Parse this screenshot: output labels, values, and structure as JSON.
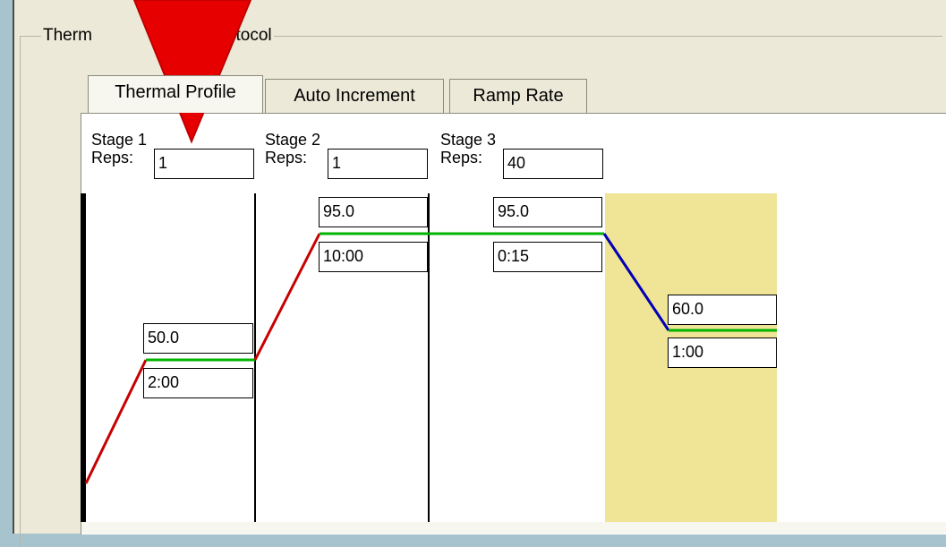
{
  "group": {
    "title_visible_left": "Therm",
    "title_visible_right": "otocol"
  },
  "tabs": [
    {
      "label": "Thermal Profile",
      "active": true
    },
    {
      "label": "Auto Increment",
      "active": false
    },
    {
      "label": "Ramp Rate",
      "active": false
    }
  ],
  "stages": [
    {
      "label": "Stage 1",
      "reps_label": "Reps:",
      "reps": "1"
    },
    {
      "label": "Stage 2",
      "reps_label": "Reps:",
      "reps": "1"
    },
    {
      "label": "Stage 3",
      "reps_label": "Reps:",
      "reps": "40"
    }
  ],
  "steps": [
    {
      "temp": "50.0",
      "time": "2:00"
    },
    {
      "temp": "95.0",
      "time": "10:00"
    },
    {
      "temp": "95.0",
      "time": "0:15"
    },
    {
      "temp": "60.0",
      "time": "1:00"
    }
  ],
  "colors": {
    "hold_line": "#00b400",
    "ramp_up": "#c80000",
    "ramp_down": "#0000b4",
    "selected_step_bg": "#f0e496",
    "overlay_arrow": "#e60000"
  },
  "overlay": {
    "icon": "red-down-arrow-icon"
  }
}
